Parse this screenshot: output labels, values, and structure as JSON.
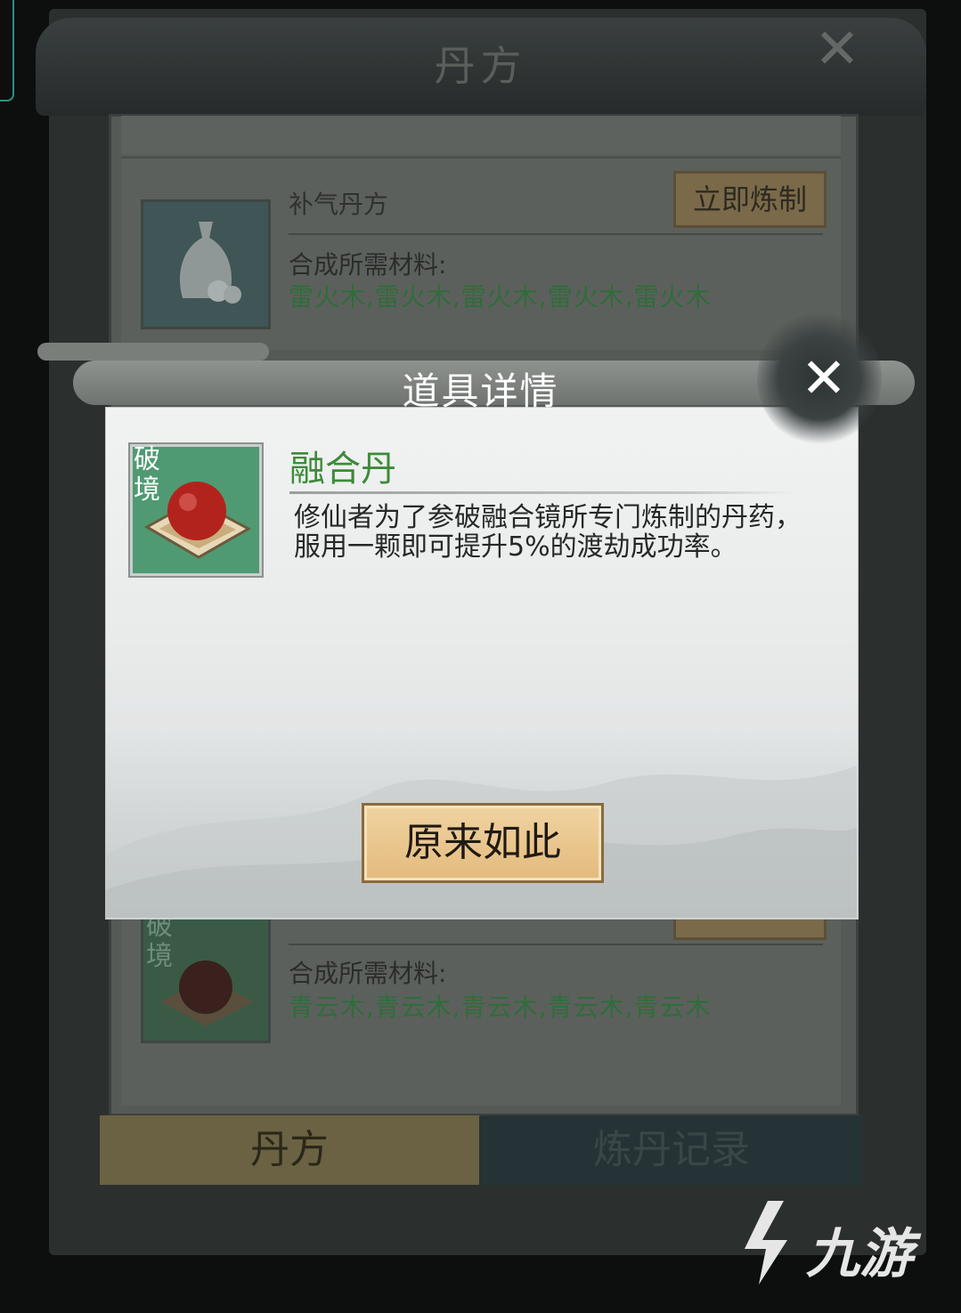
{
  "background_window": {
    "title": "丹方",
    "close_icon": "close-icon",
    "recipes": [
      {
        "name": "补气丹方",
        "craft_button": "立即炼制",
        "materials_label": "合成所需材料:",
        "materials": "雷火木,雷火木,雷火木,雷火木,雷火木",
        "icon": "pouch-icon"
      },
      {
        "name": "",
        "craft_button": "",
        "materials_label": "合成所需材料:",
        "materials": "青云木,青云木,青云木,青云木,青云木",
        "badge": "破境",
        "icon": "pill-icon"
      }
    ],
    "tabs": [
      {
        "label": "丹方",
        "active": true
      },
      {
        "label": "炼丹记录",
        "active": false
      }
    ]
  },
  "modal": {
    "title": "道具详情",
    "item": {
      "badge": "破境",
      "name": "融合丹",
      "description": "修仙者为了参破融合镜所专门炼制的丹药，服用一颗即可提升5%的渡劫成功率。"
    },
    "confirm_button": "原来如此"
  },
  "watermark": {
    "text": "九游"
  },
  "colors": {
    "item_name_green": "#3d8a3a",
    "button_gold": "#e3ba7d",
    "item_icon_bg": "#4f9a72"
  }
}
